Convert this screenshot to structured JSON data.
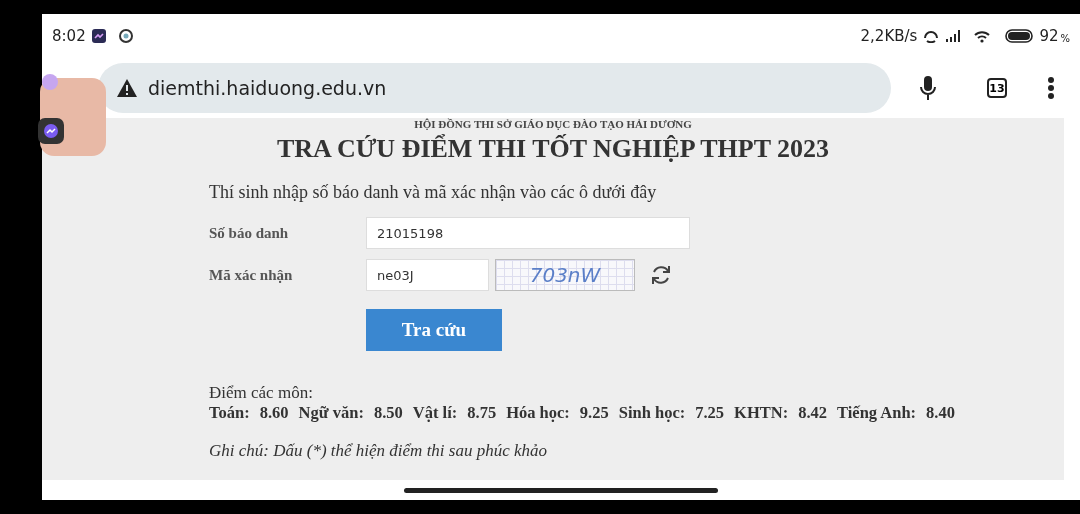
{
  "status_bar": {
    "time": "8:02",
    "speed": "2,2KB/s",
    "battery": "92",
    "battery_unit": "%"
  },
  "browser": {
    "url": "diemthi.haiduong.edu.vn",
    "tab_count": "13"
  },
  "page": {
    "council": "HỘI ĐỒNG THI SỞ GIÁO DỤC ĐÀO TẠO HẢI DƯƠNG",
    "title": "TRA CỨU ĐIỂM THI TỐT NGHIỆP THPT 2023",
    "instruction": "Thí sinh nhập số báo danh và mã xác nhận vào các ô dưới đây",
    "fields": [
      {
        "label": "Số báo danh",
        "value": "21015198",
        "kind": "text"
      },
      {
        "label": "Mã xác nhận",
        "value": "ne03J",
        "kind": "captcha",
        "captcha_text": "703nW"
      }
    ],
    "submit": "Tra cứu",
    "scores_heading": "Điểm các môn:",
    "scores": [
      {
        "subject": "Toán:",
        "score": "8.60"
      },
      {
        "subject": "Ngữ văn:",
        "score": "8.50"
      },
      {
        "subject": "Vật lí:",
        "score": "8.75"
      },
      {
        "subject": "Hóa học:",
        "score": "9.25"
      },
      {
        "subject": "Sinh học:",
        "score": "7.25"
      },
      {
        "subject": "KHTN:",
        "score": "8.42"
      },
      {
        "subject": "Tiếng Anh:",
        "score": "8.40"
      }
    ],
    "note": "Ghi chú: Dấu (*) thể hiện điểm thi sau phúc khảo"
  }
}
